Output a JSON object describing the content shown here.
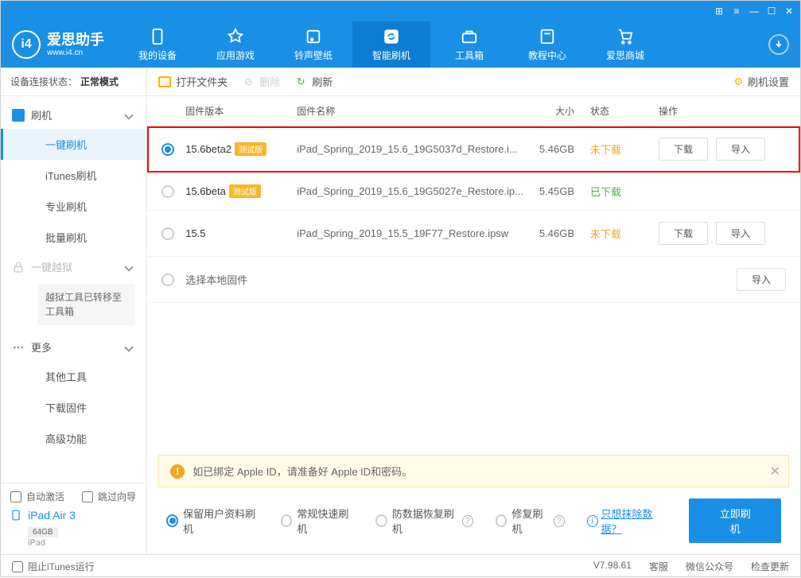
{
  "app": {
    "title": "爱思助手",
    "subtitle": "www.i4.cn"
  },
  "nav": {
    "items": [
      {
        "label": "我的设备"
      },
      {
        "label": "应用游戏"
      },
      {
        "label": "铃声壁纸"
      },
      {
        "label": "智能刷机"
      },
      {
        "label": "工具箱"
      },
      {
        "label": "教程中心"
      },
      {
        "label": "爱思商城"
      }
    ]
  },
  "status": {
    "label": "设备连接状态：",
    "value": "正常模式"
  },
  "sidebar": {
    "flash": {
      "title": "刷机",
      "items": [
        "一键刷机",
        "iTunes刷机",
        "专业刷机",
        "批量刷机"
      ]
    },
    "jailbreak": {
      "title": "一键越狱",
      "note": "越狱工具已转移至工具箱"
    },
    "more": {
      "title": "更多",
      "items": [
        "其他工具",
        "下载固件",
        "高级功能"
      ]
    },
    "auto_activate": "自动激活",
    "skip_guide": "跳过向导",
    "device": {
      "name": "iPad Air 3",
      "storage": "64GB",
      "type": "iPad"
    }
  },
  "toolbar": {
    "open_folder": "打开文件夹",
    "delete": "删除",
    "refresh": "刷新",
    "settings": "刷机设置"
  },
  "table": {
    "headers": {
      "version": "固件版本",
      "name": "固件名称",
      "size": "大小",
      "status": "状态",
      "ops": "操作"
    },
    "rows": [
      {
        "version": "15.6beta2",
        "beta": "测试版",
        "name": "iPad_Spring_2019_15.6_19G5037d_Restore.i...",
        "size": "5.46GB",
        "status": "未下载",
        "status_class": "orange",
        "checked": true,
        "show_ops": true,
        "highlighted": true
      },
      {
        "version": "15.6beta",
        "beta": "测试版",
        "name": "iPad_Spring_2019_15.6_19G5027e_Restore.ip...",
        "size": "5.45GB",
        "status": "已下载",
        "status_class": "green",
        "checked": false,
        "show_ops": false
      },
      {
        "version": "15.5",
        "beta": "",
        "name": "iPad_Spring_2019_15.5_19F77_Restore.ipsw",
        "size": "5.46GB",
        "status": "未下载",
        "status_class": "orange",
        "checked": false,
        "show_ops": true
      },
      {
        "version": "",
        "beta": "",
        "name_alt": "选择本地固件",
        "size": "",
        "status": "",
        "checked": false,
        "import_only": true
      }
    ],
    "btn_download": "下载",
    "btn_import": "导入"
  },
  "notice": "如已绑定 Apple ID，请准备好 Apple ID和密码。",
  "options": {
    "items": [
      "保留用户资料刷机",
      "常规快速刷机",
      "防数据恢复刷机",
      "修复刷机"
    ],
    "link": "只想抹除数据？",
    "flash_now": "立即刷机"
  },
  "footer": {
    "block_itunes": "阻止iTunes运行",
    "version": "V7.98.61",
    "service": "客服",
    "wechat": "微信公众号",
    "update": "检查更新"
  }
}
